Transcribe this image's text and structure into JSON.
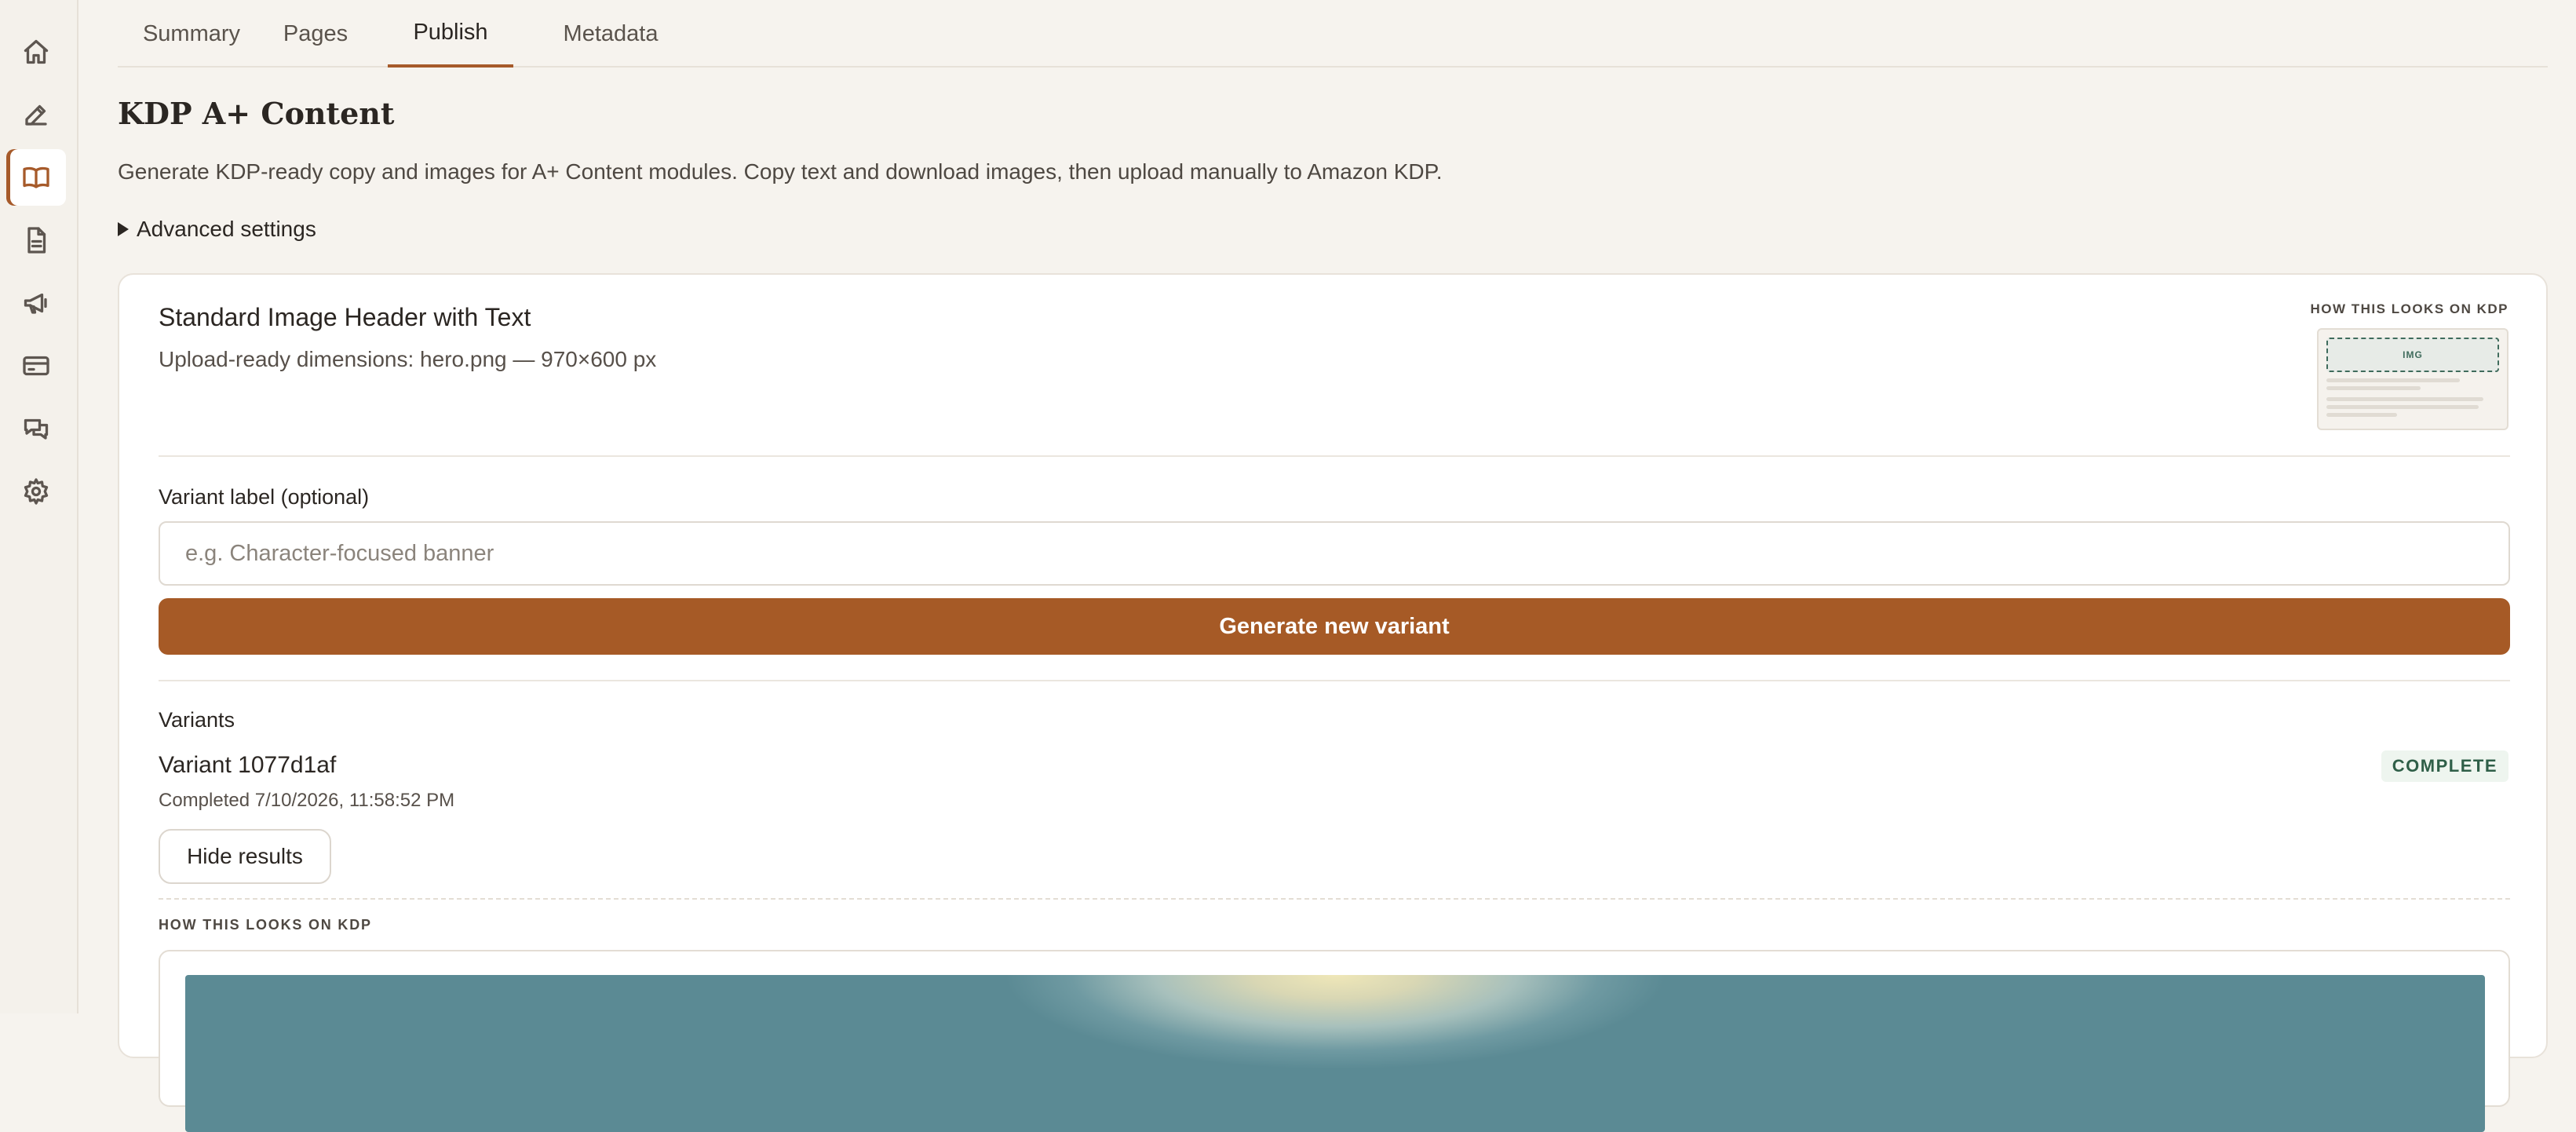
{
  "sidebar": {
    "items": [
      {
        "icon": "home-icon",
        "active": false
      },
      {
        "icon": "edit-icon",
        "active": false
      },
      {
        "icon": "book-icon",
        "active": true
      },
      {
        "icon": "document-icon",
        "active": false
      },
      {
        "icon": "megaphone-icon",
        "active": false
      },
      {
        "icon": "credit-card-icon",
        "active": false
      },
      {
        "icon": "chat-icon",
        "active": false
      },
      {
        "icon": "gear-icon",
        "active": false
      }
    ]
  },
  "tabs": [
    {
      "label": "Summary",
      "active": false
    },
    {
      "label": "Pages",
      "active": false
    },
    {
      "label": "Publish",
      "active": true
    },
    {
      "label": "Metadata",
      "active": false
    }
  ],
  "page": {
    "title": "KDP A+ Content",
    "description": "Generate KDP-ready copy and images for A+ Content modules. Copy text and download images, then upload manually to Amazon KDP.",
    "advanced_settings": "Advanced settings"
  },
  "module": {
    "title": "Standard Image Header with Text",
    "subtitle": "Upload-ready dimensions: hero.png — 970×600 px",
    "preview_label": "HOW THIS LOOKS ON KDP",
    "thumb_img_label": "IMG",
    "variant_label": "Variant label (optional)",
    "variant_placeholder": "e.g. Character-focused banner",
    "generate_button": "Generate new variant",
    "variants_heading": "Variants",
    "variant": {
      "name": "Variant 1077d1af",
      "status": "COMPLETE",
      "completed": "Completed 7/10/2026, 11:58:52 PM",
      "hide_button": "Hide results",
      "preview_label": "HOW THIS LOOKS ON KDP"
    }
  },
  "colors": {
    "accent": "#a65a26",
    "badge_bg": "#eef5ef",
    "badge_text": "#2f5f48"
  }
}
